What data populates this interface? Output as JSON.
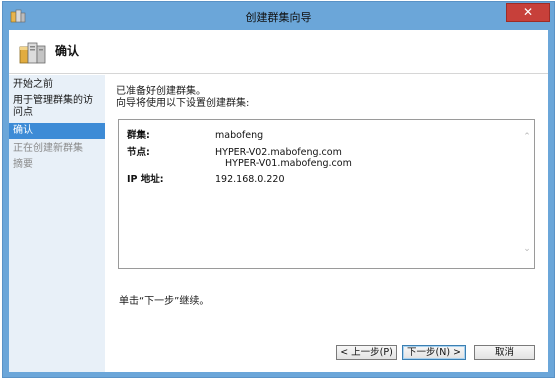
{
  "window": {
    "title": "创建群集向导",
    "close_glyph": "✕"
  },
  "header": {
    "title": "确认"
  },
  "nav": {
    "items": [
      {
        "label": "开始之前",
        "state": "normal"
      },
      {
        "label": "用于管理群集的访问点",
        "state": "normal"
      },
      {
        "label": "确认",
        "state": "active"
      },
      {
        "label": "正在创建新群集",
        "state": "dim"
      },
      {
        "label": "摘要",
        "state": "dim"
      }
    ]
  },
  "main": {
    "intro_line1": "已准备好创建群集。",
    "intro_line2": "向导将使用以下设置创建群集:",
    "summary": {
      "cluster_label": "群集:",
      "cluster_value": "mabofeng",
      "nodes_label": "节点:",
      "node1": "HYPER-V02.mabofeng.com",
      "node2": "HYPER-V01.mabofeng.com",
      "ip_label": "IP 地址:",
      "ip_value": "192.168.0.220"
    },
    "hint": "单击“下一步”继续。"
  },
  "buttons": {
    "back": "< 上一步(P)",
    "next": "下一步(N) >",
    "cancel": "取消"
  },
  "colors": {
    "frame": "#6ba6d9",
    "nav_bg": "#e8f0f8",
    "nav_active": "#3d8bd6",
    "close": "#c7403a"
  }
}
